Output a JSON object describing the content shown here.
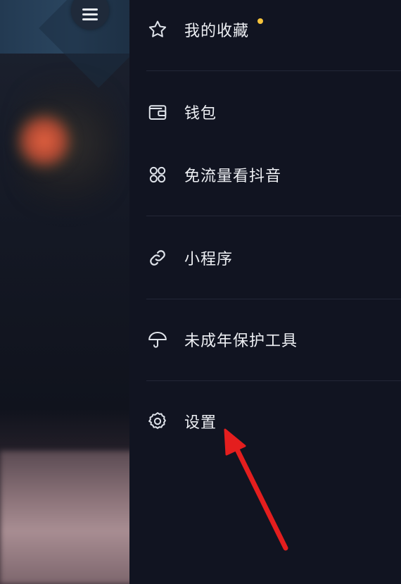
{
  "drawer": {
    "items": [
      {
        "label": "我的收藏",
        "icon": "star-icon",
        "has_badge": true
      },
      {
        "label": "钱包",
        "icon": "wallet-icon"
      },
      {
        "label": "免流量看抖音",
        "icon": "grid-four-circles-icon"
      },
      {
        "label": "小程序",
        "icon": "link-icon"
      },
      {
        "label": "未成年保护工具",
        "icon": "umbrella-icon"
      },
      {
        "label": "设置",
        "icon": "gear-icon"
      }
    ]
  },
  "colors": {
    "drawer_background": "#111421",
    "text": "#eef0f4",
    "badge": "#f6c33b",
    "annotation_arrow": "#e41e1e"
  }
}
